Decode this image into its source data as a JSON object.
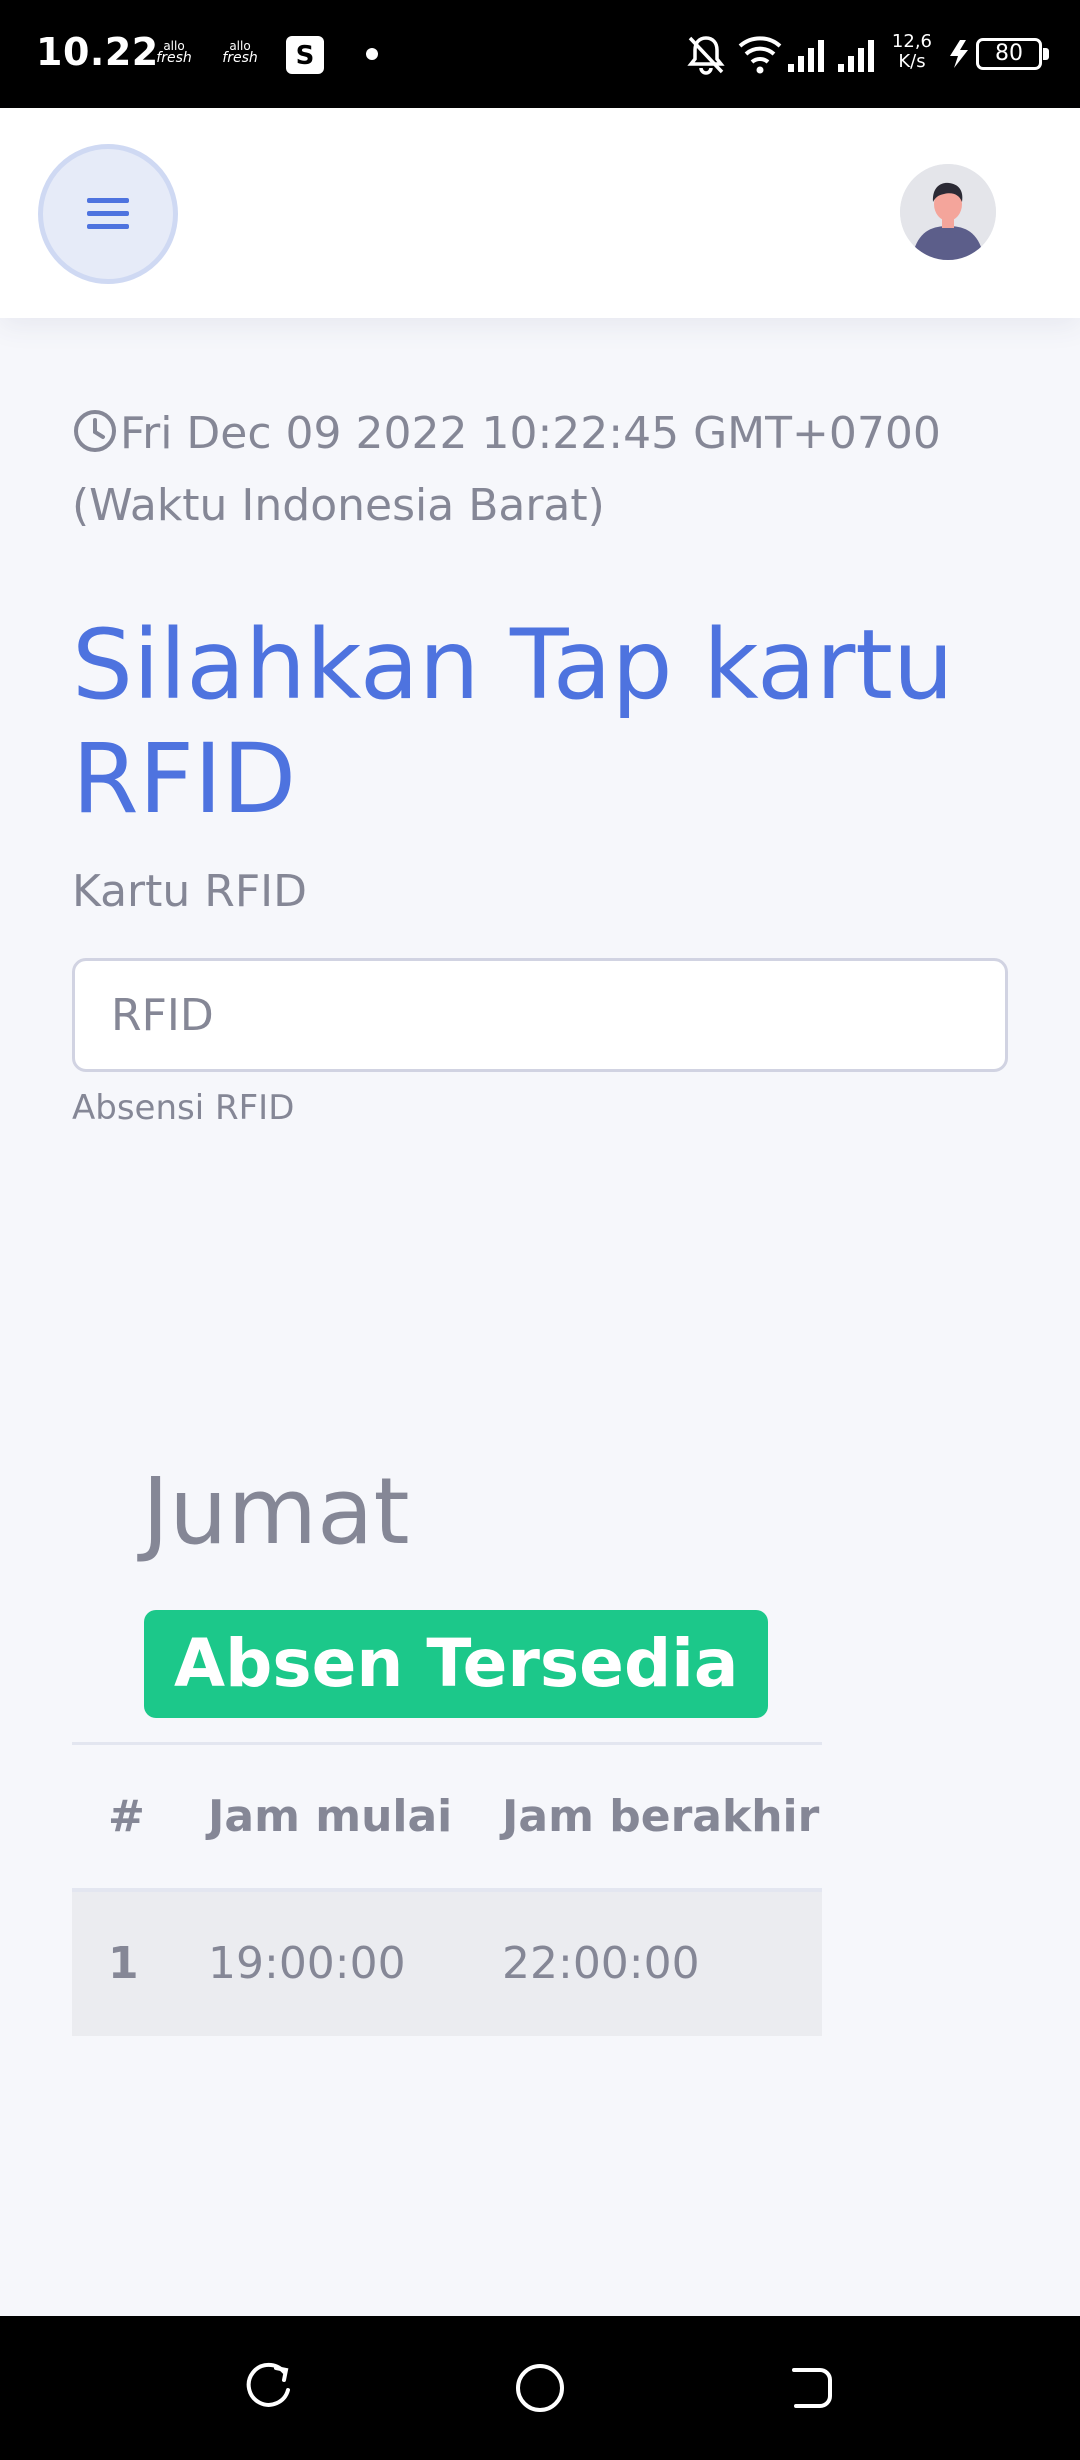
{
  "status_bar": {
    "time": "10.22",
    "apps": [
      {
        "icon": "allofresh-icon",
        "top": "allo",
        "bottom": "fresh"
      },
      {
        "icon": "allofresh-icon",
        "top": "allo",
        "bottom": "fresh"
      }
    ],
    "shop_icon_letter": "S",
    "network_speed_value": "12,6",
    "network_speed_unit": "K/s",
    "battery": "80"
  },
  "header": {
    "menu_icon": "hamburger-menu-icon",
    "avatar_icon": "user-avatar-icon"
  },
  "main": {
    "datetime": "Fri Dec 09 2022 10:22:45 GMT+0700 (Waktu Indonesia Barat)",
    "title": "Silahkan Tap kartu RFID",
    "rfid_label": "Kartu RFID",
    "rfid_placeholder": "RFID",
    "rfid_value": "",
    "rfid_help": "Absensi RFID",
    "day": "Jumat",
    "status_badge": "Absen Tersedia",
    "table": {
      "headers": [
        "#",
        "Jam mulai",
        "Jam berakhir"
      ],
      "rows": [
        [
          "1",
          "19:00:00",
          "22:00:00"
        ]
      ]
    }
  },
  "colors": {
    "primary": "#4e73df",
    "success": "#1cc88a",
    "text_muted": "#858796",
    "background": "#f6f7fb"
  }
}
